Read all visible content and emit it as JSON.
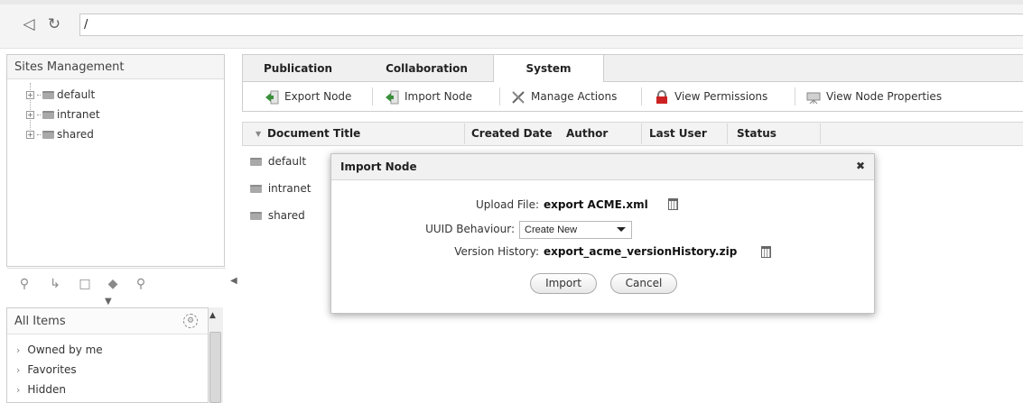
{
  "address_bar": {
    "back_icon": "back-arrow-icon",
    "refresh_icon": "refresh-icon",
    "path": "/"
  },
  "sites_panel": {
    "title": "Sites Management",
    "tree": [
      {
        "label": "default"
      },
      {
        "label": "intranet"
      },
      {
        "label": "shared"
      }
    ],
    "footer_icons": [
      "sitemap-icon",
      "relations-icon",
      "clipboard-icon",
      "tag-icon",
      "search-icon"
    ]
  },
  "all_items": {
    "title": "All Items",
    "items": [
      {
        "label": "Owned by me"
      },
      {
        "label": "Favorites"
      },
      {
        "label": "Hidden"
      }
    ]
  },
  "tabs": [
    {
      "label": "Publication"
    },
    {
      "label": "Collaboration"
    },
    {
      "label": "System",
      "active": true
    }
  ],
  "toolbar": {
    "export_node": "Export Node",
    "import_node": "Import Node",
    "manage_actions": "Manage Actions",
    "view_permissions": "View Permissions",
    "view_node_properties": "View Node Properties"
  },
  "grid": {
    "columns": [
      "Document Title",
      "Created Date",
      "Author",
      "Last User",
      "Status"
    ],
    "rows": [
      {
        "title": "default"
      },
      {
        "title": "intranet"
      },
      {
        "title": "shared"
      }
    ]
  },
  "dialog": {
    "title": "Import Node",
    "upload_file_label": "Upload File:",
    "upload_file_value": "export  ACME.xml",
    "uuid_label": "UUID Behaviour:",
    "uuid_value": "Create New",
    "version_history_label": "Version History:",
    "version_history_value": "export_acme_versionHistory.zip",
    "import_button": "Import",
    "cancel_button": "Cancel"
  },
  "colors": {
    "panel_border": "#cdcdcd",
    "header_bg": "#f3f3f3",
    "export_icon_green": "#3a8f3a",
    "permissions_icon_red": "#cc2222"
  }
}
